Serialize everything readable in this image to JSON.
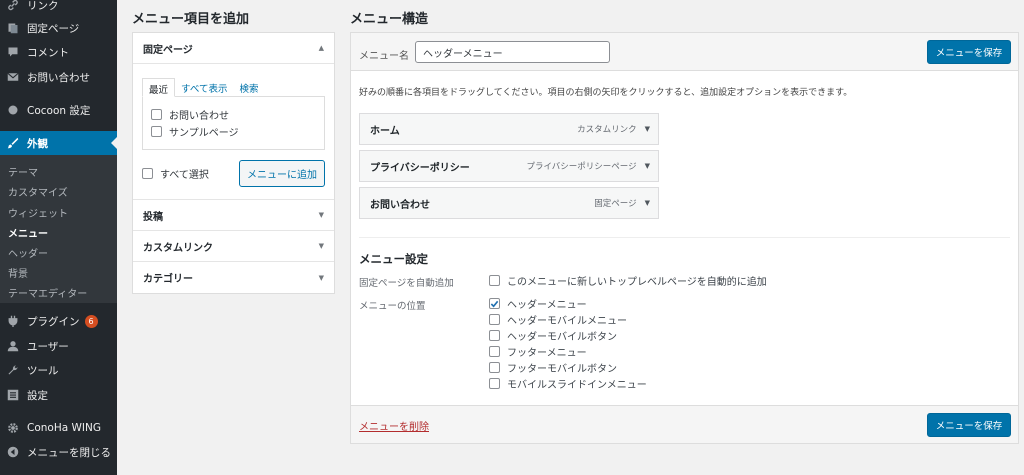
{
  "sidebar": {
    "items": [
      {
        "label": "リンク",
        "icon": "link-icon"
      },
      {
        "label": "固定ページ",
        "icon": "page-icon"
      },
      {
        "label": "コメント",
        "icon": "comment-icon"
      },
      {
        "label": "お問い合わせ",
        "icon": "mail-icon"
      },
      {
        "label": "Cocoon 設定",
        "icon": "circle-icon"
      },
      {
        "label": "外観",
        "icon": "brush-icon"
      },
      {
        "label": "プラグイン",
        "icon": "plugin-icon",
        "badge": "6"
      },
      {
        "label": "ユーザー",
        "icon": "user-icon"
      },
      {
        "label": "ツール",
        "icon": "wrench-icon"
      },
      {
        "label": "設定",
        "icon": "settings-icon"
      },
      {
        "label": "ConoHa WING",
        "icon": "gear-icon"
      },
      {
        "label": "メニューを閉じる",
        "icon": "collapse-icon"
      }
    ],
    "submenu": [
      "テーマ",
      "カスタマイズ",
      "ウィジェット",
      "メニュー",
      "ヘッダー",
      "背景",
      "テーマエディター"
    ],
    "active_submenu": "メニュー"
  },
  "add_items": {
    "title": "メニュー項目を追加",
    "pages_section": "固定ページ",
    "tabs": [
      "最近",
      "すべて表示",
      "検索"
    ],
    "pages": [
      "お問い合わせ",
      "サンプルページ"
    ],
    "select_all": "すべて選択",
    "add_button": "メニューに追加",
    "sections": [
      "投稿",
      "カスタムリンク",
      "カテゴリー"
    ]
  },
  "structure": {
    "title": "メニュー構造",
    "name_label": "メニュー名",
    "name_value": "ヘッダーメニュー",
    "save_label": "メニューを保存",
    "instructions": "好みの順番に各項目をドラッグしてください。項目の右側の矢印をクリックすると、追加設定オプションを表示できます。",
    "items": [
      {
        "title": "ホーム",
        "type": "カスタムリンク"
      },
      {
        "title": "プライバシーポリシー",
        "type": "プライバシーポリシーページ"
      },
      {
        "title": "お問い合わせ",
        "type": "固定ページ"
      }
    ],
    "settings_title": "メニュー設定",
    "auto_add_label": "固定ページを自動追加",
    "auto_add_option": "このメニューに新しいトップレベルページを自動的に追加",
    "location_label": "メニューの位置",
    "locations": [
      {
        "label": "ヘッダーメニュー",
        "checked": true
      },
      {
        "label": "ヘッダーモバイルメニュー",
        "checked": false
      },
      {
        "label": "ヘッダーモバイルボタン",
        "checked": false
      },
      {
        "label": "フッターメニュー",
        "checked": false
      },
      {
        "label": "フッターモバイルボタン",
        "checked": false
      },
      {
        "label": "モバイルスライドインメニュー",
        "checked": false
      }
    ],
    "delete_label": "メニューを削除"
  },
  "colors": {
    "accent": "#0073aa",
    "sidebar": "#23282d",
    "delete": "#b32d2e",
    "badge": "#d54e21"
  }
}
